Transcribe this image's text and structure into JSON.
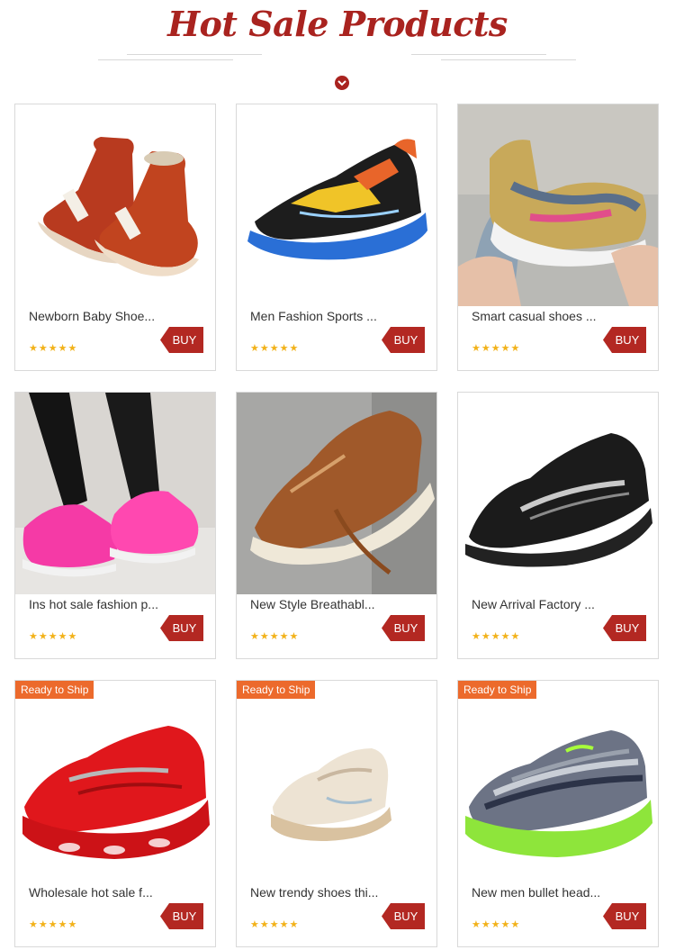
{
  "header": {
    "title": "Hot Sale Products"
  },
  "colors": {
    "accent": "#a9231f",
    "buy": "#b32822",
    "badge": "#ec6a2c",
    "stars": "#f2b21a"
  },
  "products": [
    {
      "name": "Newborn Baby Shoe...",
      "stars": "★★★★★",
      "buy_label": "BUY",
      "badge": ""
    },
    {
      "name": "Men Fashion Sports ...",
      "stars": "★★★★★",
      "buy_label": "BUY",
      "badge": ""
    },
    {
      "name": "Smart casual shoes ...",
      "stars": "★★★★★",
      "buy_label": "BUY",
      "badge": ""
    },
    {
      "name": "Ins hot sale fashion p...",
      "stars": "★★★★★",
      "buy_label": "BUY",
      "badge": ""
    },
    {
      "name": "New Style Breathabl...",
      "stars": "★★★★★",
      "buy_label": "BUY",
      "badge": ""
    },
    {
      "name": "New Arrival Factory ...",
      "stars": "★★★★★",
      "buy_label": "BUY",
      "badge": ""
    },
    {
      "name": "Wholesale hot sale f...",
      "stars": "★★★★★",
      "buy_label": "BUY",
      "badge": "Ready to Ship"
    },
    {
      "name": "New trendy shoes thi...",
      "stars": "★★★★★",
      "buy_label": "BUY",
      "badge": "Ready to Ship"
    },
    {
      "name": "New men bullet head...",
      "stars": "★★★★★",
      "buy_label": "BUY",
      "badge": "Ready to Ship"
    }
  ]
}
